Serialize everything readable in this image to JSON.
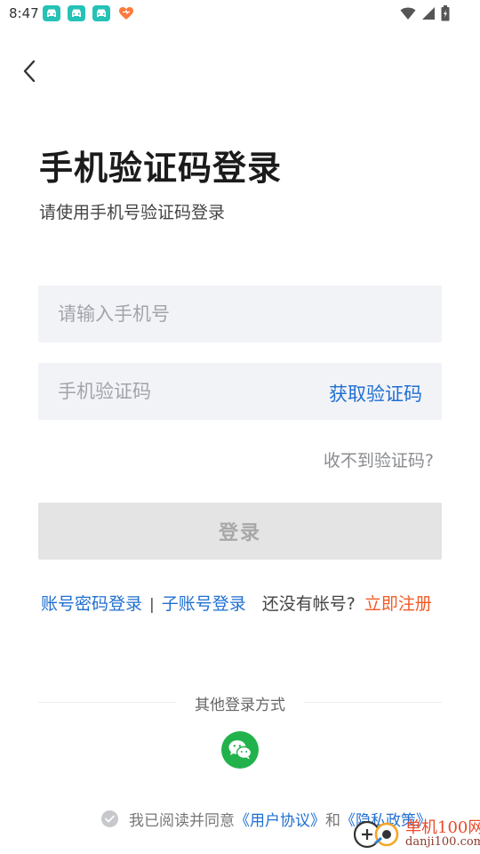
{
  "status_bar": {
    "time": "8:47",
    "notification_icons": [
      "car-notification-icon",
      "car-notification-icon",
      "car-notification-icon",
      "heart-notification-icon"
    ],
    "system_icons": [
      "wifi-icon",
      "signal-icon",
      "battery-icon"
    ]
  },
  "header": {
    "back_icon": "chevron-left-icon",
    "title": "手机验证码登录",
    "subtitle": "请使用手机号验证码登录"
  },
  "form": {
    "phone_placeholder": "请输入手机号",
    "phone_value": "",
    "code_placeholder": "手机验证码",
    "code_value": "",
    "get_code_label": "获取验证码",
    "no_code_label": "收不到验证码?",
    "login_label": "登录"
  },
  "links": {
    "password_login": "账号密码登录",
    "separator": "|",
    "sub_account_login": "子账号登录",
    "no_account": "还没有帐号?",
    "register": "立即注册"
  },
  "other_login": {
    "label": "其他登录方式",
    "wechat_icon": "wechat-icon"
  },
  "agreement": {
    "prefix": "我已阅读并同意",
    "user_agreement": "《用户协议》",
    "and": "和",
    "privacy_policy": "《隐私政策》"
  },
  "watermark": {
    "cn_text": "单机100网",
    "en_text": "danji100.com"
  },
  "colors": {
    "accent_blue": "#1f6fd1",
    "register_orange": "#f15a24",
    "input_bg": "#f2f3f7",
    "login_button_bg": "#e4e4e4",
    "wechat_green": "#22b24c"
  }
}
